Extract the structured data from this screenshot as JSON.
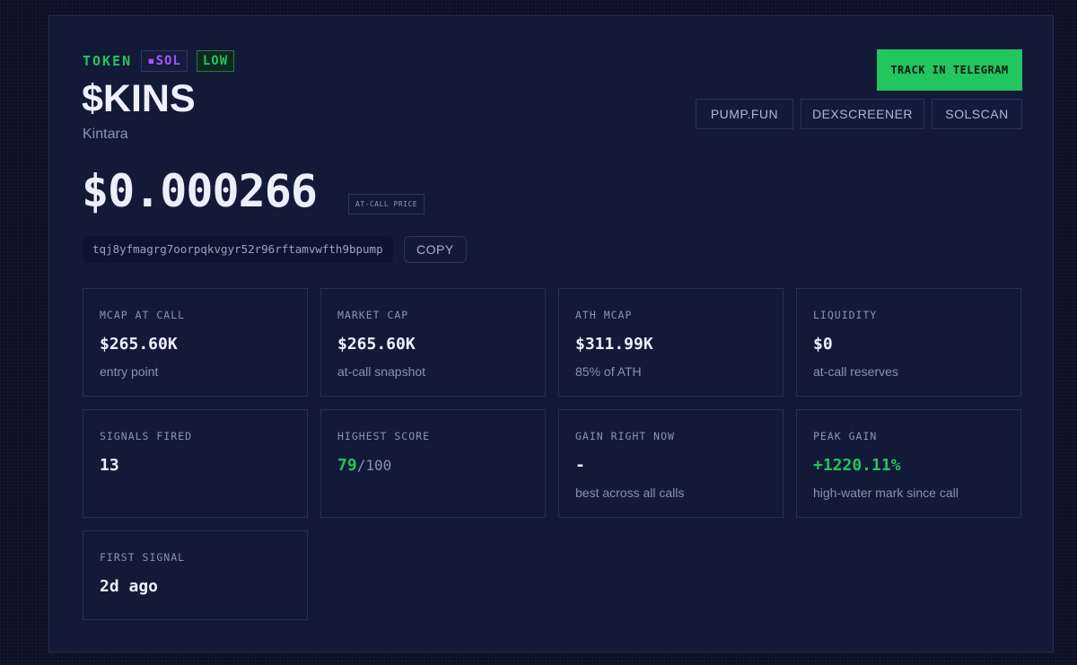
{
  "header": {
    "token_label": "TOKEN",
    "chain": "▪SOL",
    "risk": "LOW",
    "symbol": "$KINS",
    "name": "Kintara"
  },
  "price": {
    "value": "$0.000266",
    "badge": "AT-CALL PRICE"
  },
  "contract": {
    "address": "tqj8yfmagrg7oorpqkvgyr52r96rftamvwfth9bpump",
    "copy_label": "COPY"
  },
  "actions": {
    "track_label": "TRACK IN TELEGRAM",
    "links": [
      "PUMP.FUN",
      "DEXSCREENER",
      "SOLSCAN"
    ]
  },
  "stats": [
    {
      "label": "MCAP AT CALL",
      "value": "$265.60K",
      "sub": "entry point"
    },
    {
      "label": "MARKET CAP",
      "value": "$265.60K",
      "sub": "at-call snapshot"
    },
    {
      "label": "ATH MCAP",
      "value": "$311.99K",
      "sub": "85% of ATH"
    },
    {
      "label": "LIQUIDITY",
      "value": "$0",
      "sub": "at-call reserves"
    },
    {
      "label": "SIGNALS FIRED",
      "value": "13",
      "sub": ""
    },
    {
      "label": "HIGHEST SCORE",
      "value": "79",
      "value_suffix": "/100",
      "sub": ""
    },
    {
      "label": "GAIN RIGHT NOW",
      "value": "-",
      "sub": "best across all calls"
    },
    {
      "label": "PEAK GAIN",
      "value": "+1220.11%",
      "sub": "high-water mark since call"
    },
    {
      "label": "FIRST SIGNAL",
      "value": "2d ago",
      "sub": ""
    }
  ],
  "colors": {
    "accent_green": "#22c55e",
    "accent_purple": "#a855f7",
    "panel_bg": "#121a38",
    "page_bg": "#0b1025"
  }
}
